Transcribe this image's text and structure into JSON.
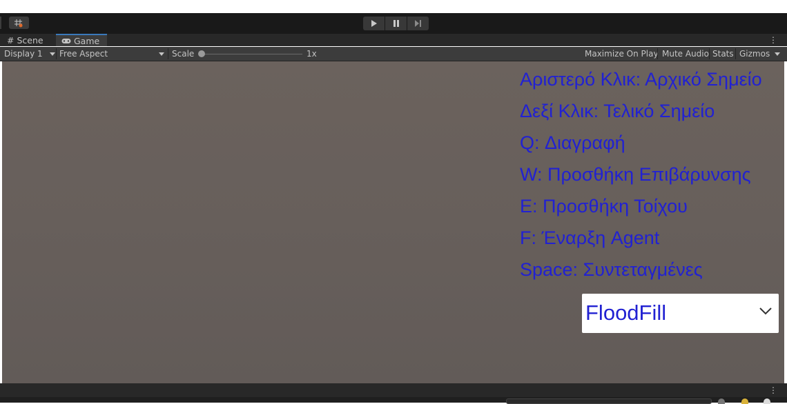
{
  "toolbar": {
    "grid_icon": "grid-snap-icon",
    "play_icon": "play-icon",
    "pause_icon": "pause-icon",
    "step_icon": "step-icon"
  },
  "tabs": [
    {
      "label": "Scene",
      "icon": "grid-icon"
    },
    {
      "label": "Game",
      "icon": "gamepad-icon",
      "active": true
    }
  ],
  "gamebar": {
    "display": "Display 1",
    "aspect": "Free Aspect",
    "scale_label": "Scale",
    "scale_value": "1x",
    "maximize": "Maximize On Play",
    "mute": "Mute Audio",
    "stats": "Stats",
    "gizmos": "Gizmos"
  },
  "game": {
    "hints": [
      "Αριστερό Κλικ: Αρχικό Σημείο",
      "Δεξί Κλικ: Τελικό Σημείο",
      "Q: Διαγραφή",
      "W: Προσθήκη Επιβάρυνσης",
      "E: Προσθήκη Τοίχου",
      "F: Έναρξη Agent",
      "Space:  Συντεταγμένες"
    ],
    "algorithm_dropdown": "FloodFill",
    "text_color": "#2121d2"
  }
}
